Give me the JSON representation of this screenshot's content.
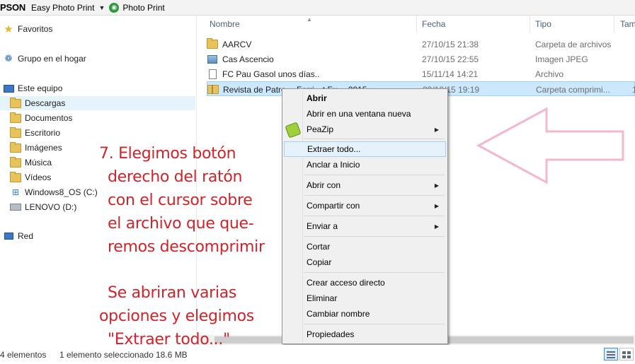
{
  "toolbar": {
    "brand": "PSON",
    "app": "Easy Photo Print",
    "dropdown_glyph": "▼",
    "photo_print": "Photo Print"
  },
  "nav": {
    "favorites": "Favoritos",
    "homegroup": "Grupo en el hogar",
    "this_pc": "Este equipo",
    "items": [
      "Descargas",
      "Documentos",
      "Escritorio",
      "Imágenes",
      "Música",
      "Vídeos",
      "Windows8_OS (C:)",
      "LENOVO (D:)"
    ],
    "network": "Red"
  },
  "columns": {
    "name": "Nombre",
    "date": "Fecha",
    "type": "Tipo",
    "size": "Tam"
  },
  "files": [
    {
      "name": "AARCV",
      "date": "27/10/15 21:38",
      "type": "Carpeta de archivos",
      "size": "",
      "icon": "folder-icon"
    },
    {
      "name": "Cas Ascencio",
      "date": "27/10/15 22:55",
      "type": "Imagen JPEG",
      "size": "",
      "icon": "image-icon"
    },
    {
      "name": "FC Pau Gasol unos días..",
      "date": "15/11/14 14:21",
      "type": "Archivo",
      "size": "",
      "icon": "file-icon"
    },
    {
      "name": "Revista de Patro… Ferri…t Fu… 2015",
      "date": "29/10/15 19:19",
      "type": "Carpeta comprimi...",
      "size": "1",
      "icon": "zip-folder-icon"
    }
  ],
  "context_menu": {
    "open": "Abrir",
    "open_new_window": "Abrir en una ventana nueva",
    "peazip": "PeaZip",
    "extract_all": "Extraer todo...",
    "pin_start": "Anclar a Inicio",
    "open_with": "Abrir con",
    "share_with": "Compartir con",
    "send_to": "Enviar a",
    "cut": "Cortar",
    "copy": "Copiar",
    "create_shortcut": "Crear acceso directo",
    "delete": "Eliminar",
    "rename": "Cambiar nombre",
    "properties": "Propiedades",
    "submenu_glyph": "▶"
  },
  "annotation": {
    "lines": [
      "7. Elegimos botón",
      "derecho del ratón",
      "con el cursor sobre",
      "el archivo que que-",
      "remos descomprimir",
      "Se abriran varias",
      "opciones y elegimos",
      "\"Extraer todo...\""
    ],
    "color": "#d2232a",
    "arrow_color": "#f4b8c8"
  },
  "status": {
    "count": "4 elementos",
    "selection": "1 elemento seleccionado",
    "size": "18.6 MB"
  }
}
